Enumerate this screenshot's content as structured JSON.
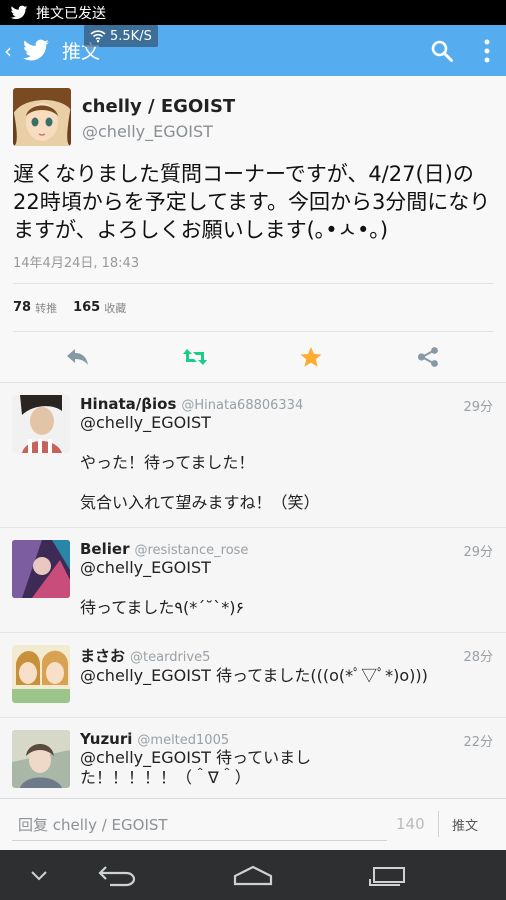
{
  "status_bar": {
    "notification": "推文已发送"
  },
  "net_speed": "5.5K/S",
  "action_bar": {
    "title": "推文",
    "back": "‹"
  },
  "tweet": {
    "author_name": "chelly / EGOIST",
    "author_handle": "@chelly_EGOIST",
    "text": "遅くなりました質問コーナーですが、4/27(日)の22時頃からを予定してます。今回から3分間になりますが、よろしくお願いします(｡•ㅅ•｡)",
    "time": "14年4月24日, 18:43",
    "retweets": "78",
    "retweets_label": "转推",
    "favorites": "165",
    "favorites_label": "收藏"
  },
  "replies": [
    {
      "name": "Hinata/βios",
      "handle": "@Hinata68806334",
      "time": "29分",
      "lines": [
        "@chelly_EGOIST",
        "",
        "やった！待ってました！",
        "",
        "気合い入れて望みますね！（笑）"
      ]
    },
    {
      "name": "Belier",
      "handle": "@resistance_rose",
      "time": "29分",
      "lines": [
        "@chelly_EGOIST",
        "",
        "待ってました٩(*´˘`*)۶"
      ]
    },
    {
      "name": "まさお",
      "handle": "@teardrive5",
      "time": "28分",
      "lines": [
        "@chelly_EGOIST 待ってました(((o(*ﾟ▽ﾟ*)o)))"
      ]
    },
    {
      "name": "Yuzuri",
      "handle": "@melted1005",
      "time": "22分",
      "lines": [
        "@chelly_EGOIST 待っていまし",
        "た！！！！！（＾∇＾）"
      ]
    }
  ],
  "composer": {
    "placeholder": "回复 chelly / EGOIST",
    "counter": "140",
    "send_label": "推文"
  },
  "colors": {
    "accent": "#55acee",
    "retweet": "#19cf86",
    "favorite": "#ffac33",
    "action_gray": "#8899a6"
  },
  "icons": [
    "twitter-bird-icon",
    "wifi-icon",
    "search-icon",
    "overflow-menu-icon",
    "reply-icon",
    "retweet-icon",
    "favorite-star-icon",
    "share-icon",
    "nav-down-icon",
    "nav-back-icon",
    "nav-home-icon",
    "nav-recents-icon"
  ]
}
